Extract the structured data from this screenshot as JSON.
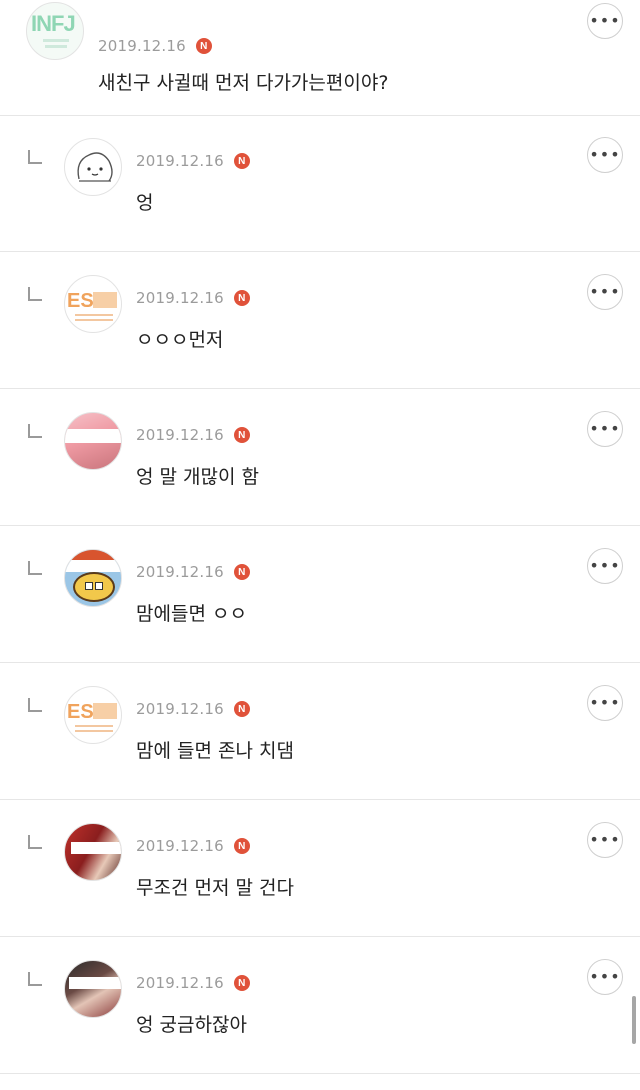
{
  "comments": [
    {
      "date": "2019.12.16",
      "badge": "N",
      "text": "새친구 사귈때 먼저 다가가는편이야?",
      "avatar_icon": "infj-avatar",
      "avatar_label": "INFJ"
    },
    {
      "date": "2019.12.16",
      "badge": "N",
      "text": "엉",
      "avatar_icon": "cartoon-face-avatar"
    },
    {
      "date": "2019.12.16",
      "badge": "N",
      "text": "ㅇㅇㅇ먼저",
      "avatar_icon": "estp-avatar",
      "avatar_label": "ES"
    },
    {
      "date": "2019.12.16",
      "badge": "N",
      "text": "엉 말 개많이 함",
      "avatar_icon": "photo-avatar"
    },
    {
      "date": "2019.12.16",
      "badge": "N",
      "text": "맘에들면 ㅇㅇ",
      "avatar_icon": "cartoon-avatar"
    },
    {
      "date": "2019.12.16",
      "badge": "N",
      "text": "맘에 들면 존나 치댐",
      "avatar_icon": "estp-avatar",
      "avatar_label": "ES"
    },
    {
      "date": "2019.12.16",
      "badge": "N",
      "text": "무조건 먼저 말 건다",
      "avatar_icon": "photo-avatar"
    },
    {
      "date": "2019.12.16",
      "badge": "N",
      "text": "엉 궁금하잖아",
      "avatar_icon": "photo-avatar"
    }
  ],
  "more_label": "•••",
  "colors": {
    "badge": "#e0523a",
    "date": "#9b9b9b",
    "text": "#222222",
    "divider": "#e6e6e6"
  }
}
